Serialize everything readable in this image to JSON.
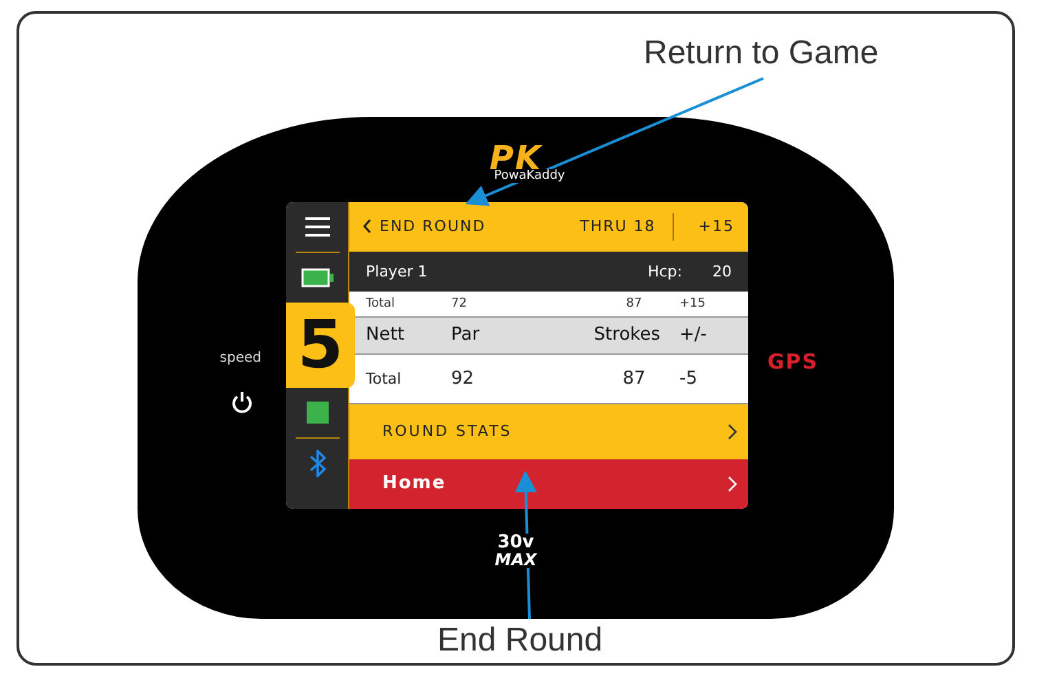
{
  "annotations": [
    {
      "label": "Return to Game"
    },
    {
      "label": "End Round"
    }
  ],
  "logo": {
    "mark": "PK",
    "brand": "PowaKaddy"
  },
  "side_labels": {
    "speed": "speed",
    "gps": "GPS"
  },
  "sidebar": {
    "speed_setting": "5"
  },
  "header": {
    "back_label": "END ROUND",
    "thru": "THRU 18",
    "score": "+15"
  },
  "player": {
    "name": "Player 1",
    "hcp_label": "Hcp:",
    "hcp": "20"
  },
  "gross_row": [
    "Total",
    "72",
    "87",
    "+15"
  ],
  "nett_table": {
    "columns": [
      "Nett",
      "Par",
      "Strokes",
      "+/-"
    ],
    "rows": [
      [
        "Total",
        "92",
        "87",
        "-5"
      ]
    ]
  },
  "menu": [
    {
      "label": "ROUND STATS",
      "kind": "stats"
    },
    {
      "label": "Home",
      "kind": "home"
    }
  ],
  "model_badge": {
    "line_1": "30v",
    "line_2": "MAX"
  }
}
